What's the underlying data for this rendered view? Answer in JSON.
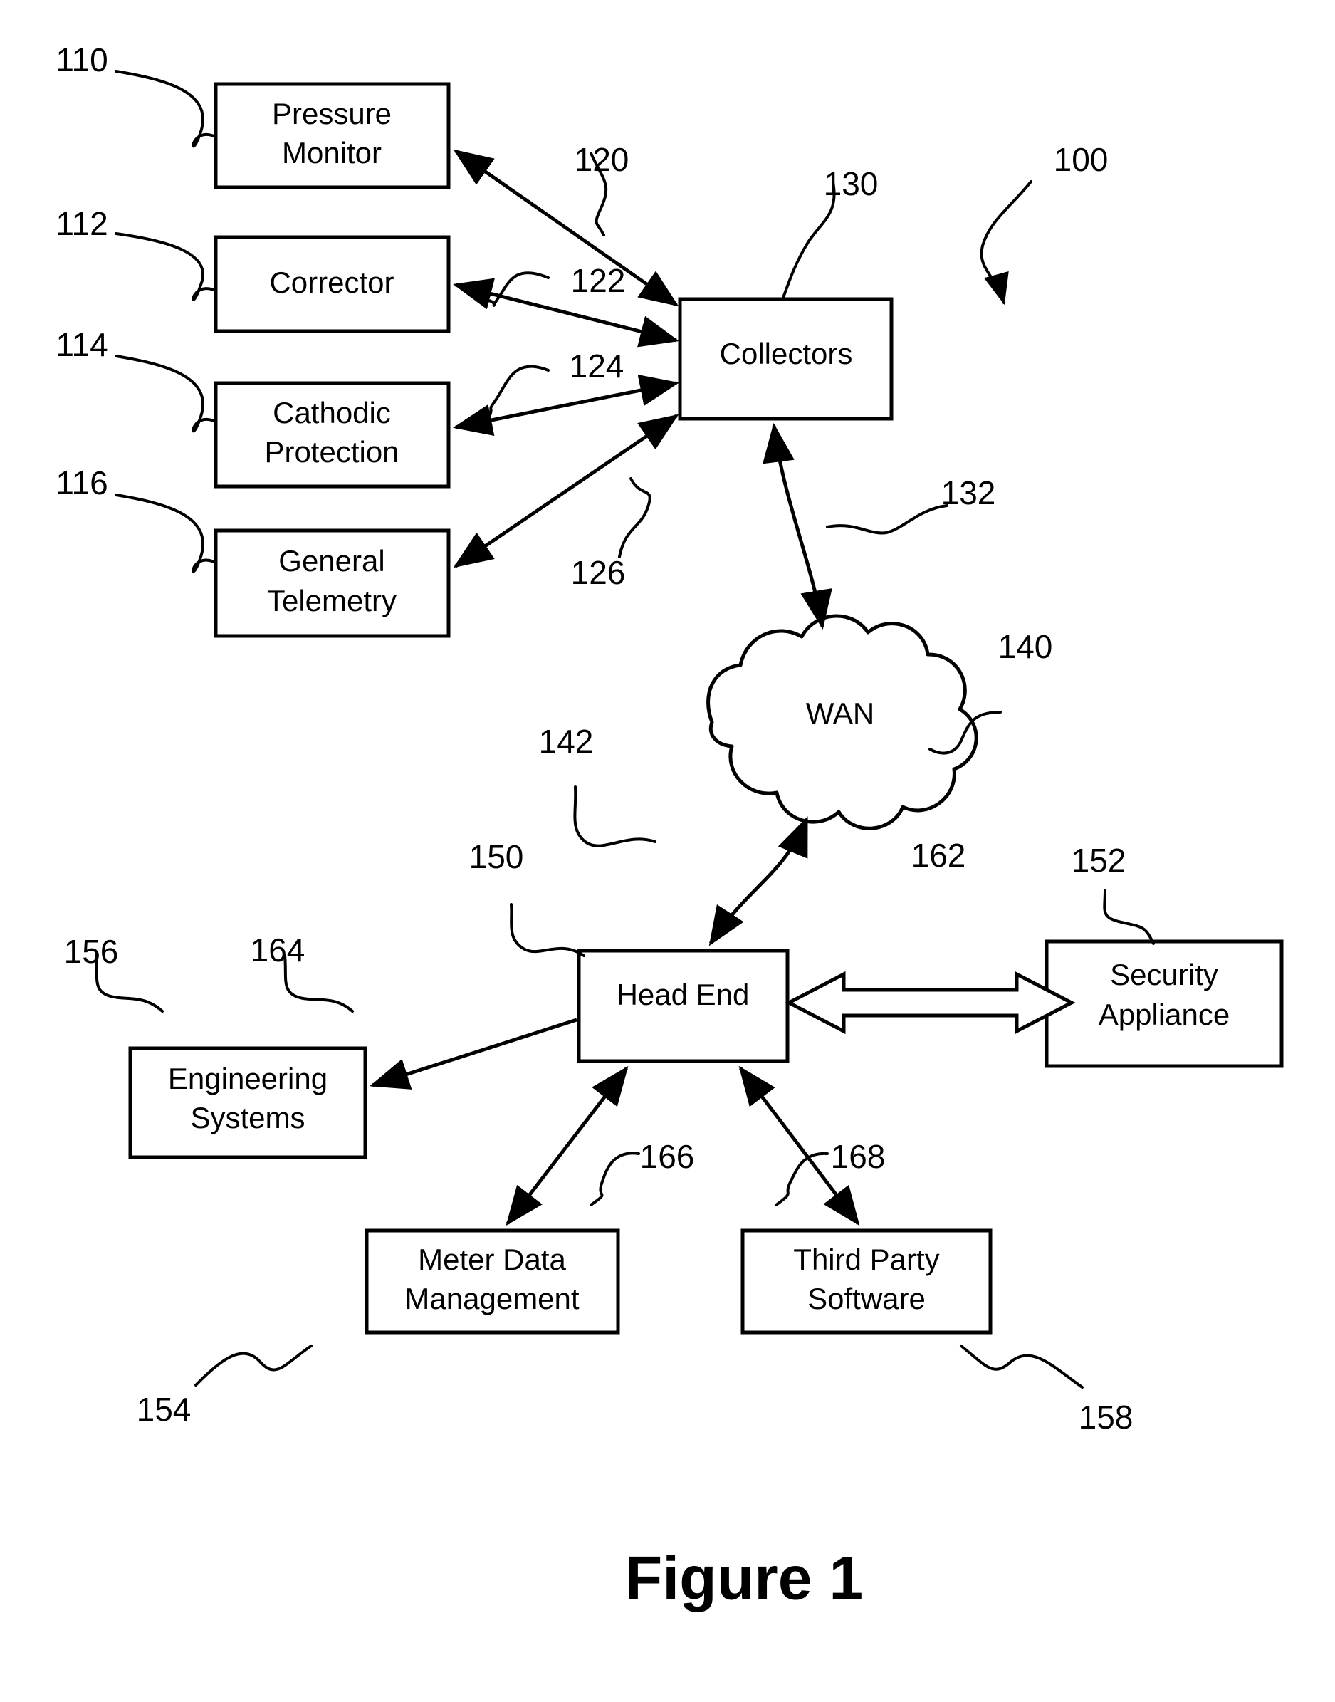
{
  "figure": {
    "caption": "Figure 1",
    "system_ref": "100"
  },
  "nodes": [
    {
      "id": "pressure_monitor",
      "label_line1": "Pressure",
      "label_line2": "Monitor",
      "ref": "110"
    },
    {
      "id": "corrector",
      "label_line1": "Corrector",
      "label_line2": "",
      "ref": "112"
    },
    {
      "id": "cathodic_protection",
      "label_line1": "Cathodic",
      "label_line2": "Protection",
      "ref": "114"
    },
    {
      "id": "general_telemetry",
      "label_line1": "General",
      "label_line2": "Telemetry",
      "ref": "116"
    },
    {
      "id": "collectors",
      "label_line1": "Collectors",
      "label_line2": "",
      "ref": "130"
    },
    {
      "id": "wan",
      "label_line1": "WAN",
      "label_line2": "",
      "ref": "140"
    },
    {
      "id": "head_end",
      "label_line1": "Head End",
      "label_line2": "",
      "ref": "150"
    },
    {
      "id": "security_appliance",
      "label_line1": "Security",
      "label_line2": "Appliance",
      "ref": "152"
    },
    {
      "id": "engineering_systems",
      "label_line1": "Engineering",
      "label_line2": "Systems",
      "ref": "156"
    },
    {
      "id": "meter_data_mgmt",
      "label_line1": "Meter Data",
      "label_line2": "Management",
      "ref": "154"
    },
    {
      "id": "third_party_sw",
      "label_line1": "Third Party",
      "label_line2": "Software",
      "ref": "158"
    }
  ],
  "connection_refs": {
    "pressure_to_collectors": "120",
    "corrector_to_collectors": "122",
    "cathodic_to_collectors": "124",
    "telemetry_to_collectors": "126",
    "collectors_to_wan": "132",
    "wan_to_headend": "142",
    "headend_to_security": "162",
    "headend_to_engineering": "164",
    "headend_to_meterdata": "166",
    "headend_to_thirdparty": "168"
  },
  "colors": {
    "stroke": "#000000",
    "fill": "#ffffff",
    "background": "#ffffff"
  }
}
